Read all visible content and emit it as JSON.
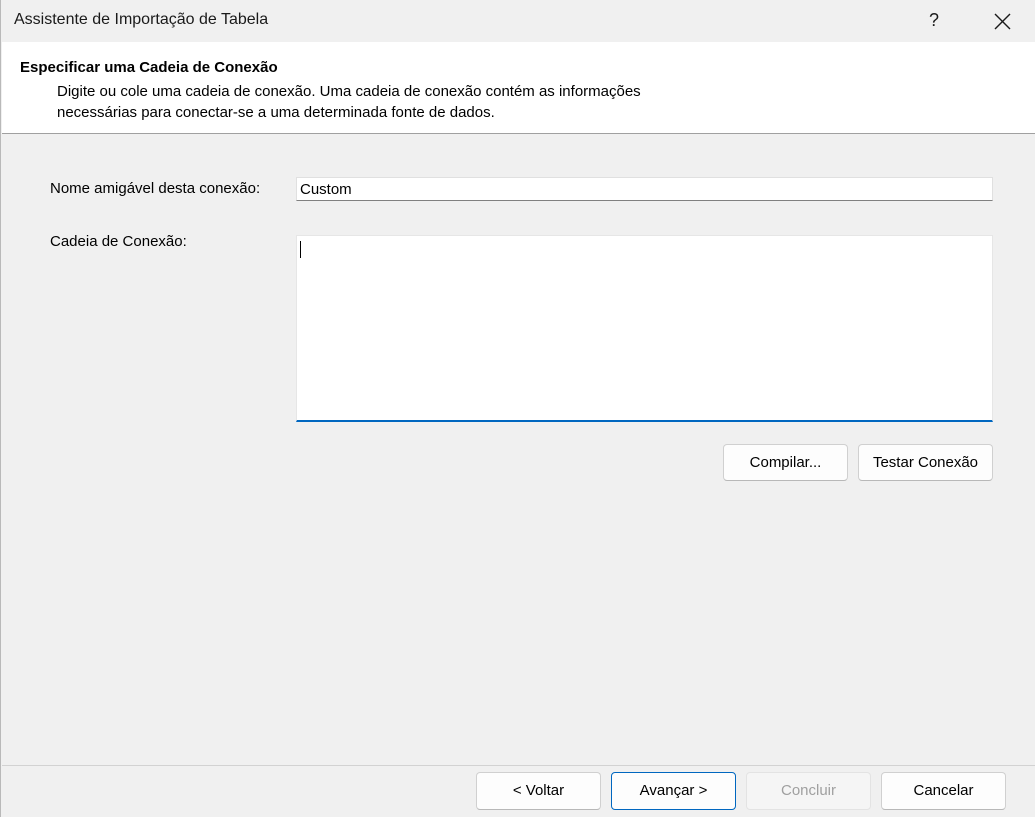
{
  "window": {
    "title": "Assistente de Importação de Tabela",
    "help_label": "?"
  },
  "header": {
    "heading": "Especificar uma Cadeia de Conexão",
    "description_line1": "Digite ou cole uma cadeia de conexão. Uma cadeia de conexão contém as informações",
    "description_line2": "necessárias para conectar-se a uma determinada fonte de dados."
  },
  "form": {
    "friendly_name_label": "Nome amigável desta conexão:",
    "friendly_name_value": "Custom",
    "connection_string_label": "Cadeia de Conexão:",
    "connection_string_value": ""
  },
  "actions": {
    "build_label": "Compilar...",
    "test_label": "Testar Conexão"
  },
  "footer": {
    "back_label": "< Voltar",
    "next_label": "Avançar >",
    "finish_label": "Concluir",
    "cancel_label": "Cancelar"
  },
  "colors": {
    "accent": "#0067c0",
    "background": "#f0f0f0",
    "header_background": "#ffffff",
    "disabled_text": "#a0a0a0"
  },
  "icons": {
    "close": "close-icon",
    "help": "help-icon"
  }
}
